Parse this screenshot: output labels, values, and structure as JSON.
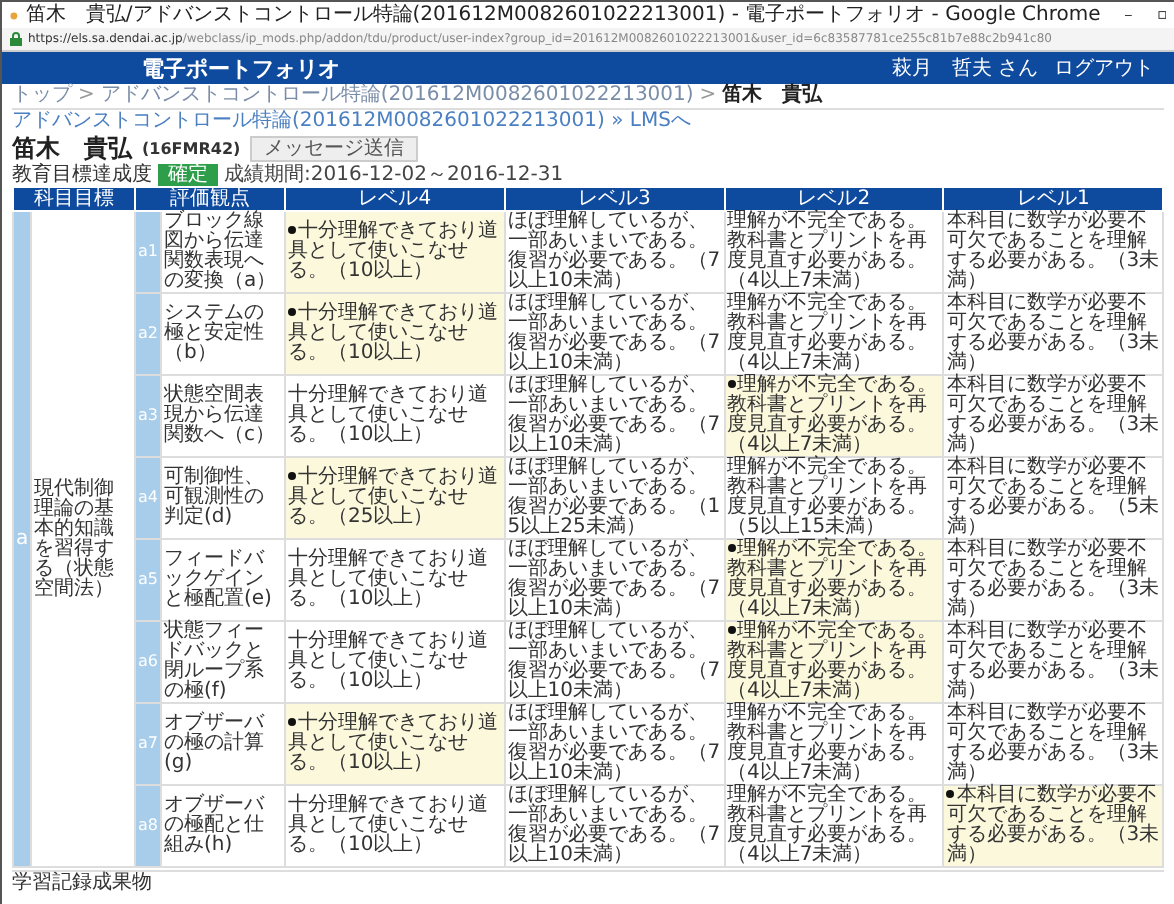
{
  "window": {
    "title": "笛木　貴弘/アドバンストコントロール特論(201612M0082601022213001) - 電子ポートフォリオ - Google Chrome"
  },
  "address_bar": {
    "secure_host": "https://els.sa.dendai.ac.jp",
    "path": "/webclass/ip_mods.php/addon/tdu/product/user-index?group_id=201612M0082601022213001&user_id=6c83587781ce255c81b7e88c2b941c80"
  },
  "header": {
    "site_title": "電子ポートフォリオ",
    "user": "萩月　哲夫 さん",
    "logout": "ログアウト"
  },
  "breadcrumb": [
    "トップ",
    "アドバンストコントロール特論(201612M0082601022213001)",
    "笛木　貴弘"
  ],
  "breadcrumb_separator": ">",
  "course_link": "アドバンストコントロール特論(201612M0082601022213001) » LMSへ",
  "student": {
    "name": "笛木　貴弘",
    "id": "(16FMR42)",
    "message_button": "メッセージ送信"
  },
  "achievement": {
    "label": "教育目標達成度",
    "status": "確定",
    "period": "成績期間:2016-12-02～2016-12-31"
  },
  "table": {
    "columns": [
      "科目目標",
      "評価観点",
      "レベル4",
      "レベル3",
      "レベル2",
      "レベル1"
    ],
    "goal": {
      "code": "a",
      "text": "現代制御理論の基本的知識を習得する（状態空間法）"
    },
    "rows": [
      {
        "code": "a1",
        "item": "ブロック線図から伝達関数表現への変換（a）",
        "levels": [
          {
            "text": "十分理解できており道具として使いこなせる。（10以上）",
            "selected": true
          },
          {
            "text": "ほぼ理解しているが、一部あいまいである。復習が必要である。（7以上10未満）",
            "selected": false
          },
          {
            "text": "理解が不完全である。教科書とプリントを再度見直す必要がある。（4以上7未満）",
            "selected": false
          },
          {
            "text": "本科目に数学が必要不可欠であることを理解する必要がある。（3未満）",
            "selected": false
          }
        ]
      },
      {
        "code": "a2",
        "item": "システムの極と安定性（b）",
        "levels": [
          {
            "text": "十分理解できており道具として使いこなせる。（10以上）",
            "selected": true
          },
          {
            "text": "ほぼ理解しているが、一部あいまいである。復習が必要である。（7以上10未満）",
            "selected": false
          },
          {
            "text": "理解が不完全である。教科書とプリントを再度見直す必要がある。（4以上7未満）",
            "selected": false
          },
          {
            "text": "本科目に数学が必要不可欠であることを理解する必要がある。（3未満）",
            "selected": false
          }
        ]
      },
      {
        "code": "a3",
        "item": "状態空間表現から伝達関数へ（c）",
        "levels": [
          {
            "text": "十分理解できており道具として使いこなせる。（10以上）",
            "selected": false
          },
          {
            "text": "ほぼ理解しているが、一部あいまいである。復習が必要である。（7以上10未満）",
            "selected": false
          },
          {
            "text": "理解が不完全である。教科書とプリントを再度見直す必要がある。（4以上7未満）",
            "selected": true
          },
          {
            "text": "本科目に数学が必要不可欠であることを理解する必要がある。（3未満）",
            "selected": false
          }
        ]
      },
      {
        "code": "a4",
        "item": "可制御性、可観測性の判定(d)",
        "levels": [
          {
            "text": "十分理解できており道具として使いこなせる。（25以上）",
            "selected": true
          },
          {
            "text": "ほぼ理解しているが、一部あいまいである。復習が必要である。（15以上25未満）",
            "selected": false
          },
          {
            "text": "理解が不完全である。教科書とプリントを再度見直す必要がある。（5以上15未満）",
            "selected": false
          },
          {
            "text": "本科目に数学が必要不可欠であることを理解する必要がある。（5未満）",
            "selected": false
          }
        ]
      },
      {
        "code": "a5",
        "item": "フィードバックゲインと極配置(e)",
        "levels": [
          {
            "text": "十分理解できており道具として使いこなせる。（10以上）",
            "selected": false
          },
          {
            "text": "ほぼ理解しているが、一部あいまいである。復習が必要である。（7以上10未満）",
            "selected": false
          },
          {
            "text": "理解が不完全である。教科書とプリントを再度見直す必要がある。（4以上7未満）",
            "selected": true
          },
          {
            "text": "本科目に数学が必要不可欠であることを理解する必要がある。（3未満）",
            "selected": false
          }
        ]
      },
      {
        "code": "a6",
        "item": "状態フィードバックと閉ループ系の極(f)",
        "levels": [
          {
            "text": "十分理解できており道具として使いこなせる。（10以上）",
            "selected": false
          },
          {
            "text": "ほぼ理解しているが、一部あいまいである。復習が必要である。（7以上10未満）",
            "selected": false
          },
          {
            "text": "理解が不完全である。教科書とプリントを再度見直す必要がある。（4以上7未満）",
            "selected": true
          },
          {
            "text": "本科目に数学が必要不可欠であることを理解する必要がある。（3未満）",
            "selected": false
          }
        ]
      },
      {
        "code": "a7",
        "item": "オブザーバの極の計算(g)",
        "levels": [
          {
            "text": "十分理解できており道具として使いこなせる。（10以上）",
            "selected": true
          },
          {
            "text": "ほぼ理解しているが、一部あいまいである。復習が必要である。（7以上10未満）",
            "selected": false
          },
          {
            "text": "理解が不完全である。教科書とプリントを再度見直す必要がある。（4以上7未満）",
            "selected": false
          },
          {
            "text": "本科目に数学が必要不可欠であることを理解する必要がある。（3未満）",
            "selected": false
          }
        ]
      },
      {
        "code": "a8",
        "item": "オブザーバの極配と仕組み(h)",
        "levels": [
          {
            "text": "十分理解できており道具として使いこなせる。（10以上）",
            "selected": false
          },
          {
            "text": "ほぼ理解しているが、一部あいまいである。復習が必要である。（7以上10未満）",
            "selected": false
          },
          {
            "text": "理解が不完全である。教科書とプリントを再度見直す必要がある。（4以上7未満）",
            "selected": false
          },
          {
            "text": "本科目に数学が必要不可欠であることを理解する必要がある。（3未満）",
            "selected": true
          }
        ]
      }
    ]
  },
  "section_title": "学習記録成果物"
}
